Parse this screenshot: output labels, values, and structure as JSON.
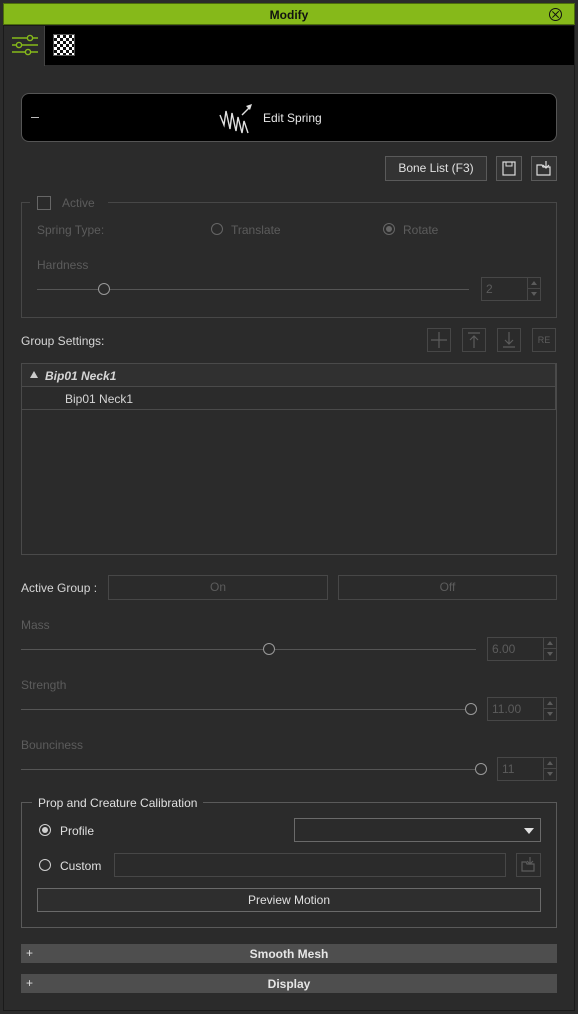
{
  "window": {
    "title": "Modify"
  },
  "tabs": [
    {
      "name": "Modify",
      "icon": "sliders-icon",
      "active": true
    },
    {
      "name": "Texture",
      "icon": "checker-icon",
      "active": false
    }
  ],
  "edit_spring": {
    "label": "Edit Spring",
    "collapse_symbol": "–"
  },
  "toolbar": {
    "bone_list_label": "Bone List (F3)"
  },
  "active_group": {
    "active_label": "Active",
    "spring_type_label": "Spring Type:",
    "translate_label": "Translate",
    "rotate_label": "Rotate",
    "hardness_label": "Hardness",
    "hardness_value": "2"
  },
  "group_settings": {
    "label": "Group Settings:",
    "reset_label": "RE"
  },
  "tree": {
    "parent": "Bip01 Neck1",
    "child": "Bip01 Neck1"
  },
  "active_group_toggle": {
    "label": "Active Group :",
    "on": "On",
    "off": "Off"
  },
  "mass": {
    "label": "Mass",
    "value": "6.00",
    "level": 0.55
  },
  "strength": {
    "label": "Strength",
    "value": "11.00",
    "level": 1.0
  },
  "bounciness": {
    "label": "Bounciness",
    "value": "11",
    "level": 1.0
  },
  "calibration": {
    "title": "Prop and Creature Calibration",
    "profile_label": "Profile",
    "profile_value": "",
    "custom_label": "Custom",
    "custom_value": "",
    "preview_label": "Preview Motion"
  },
  "sections": [
    {
      "label": "Smooth Mesh",
      "symbol": "+"
    },
    {
      "label": "Display",
      "symbol": "+"
    }
  ],
  "colors": {
    "accent": "#86b91a",
    "panel": "#2b2b2b",
    "disabled_text": "#5c5c5c"
  }
}
